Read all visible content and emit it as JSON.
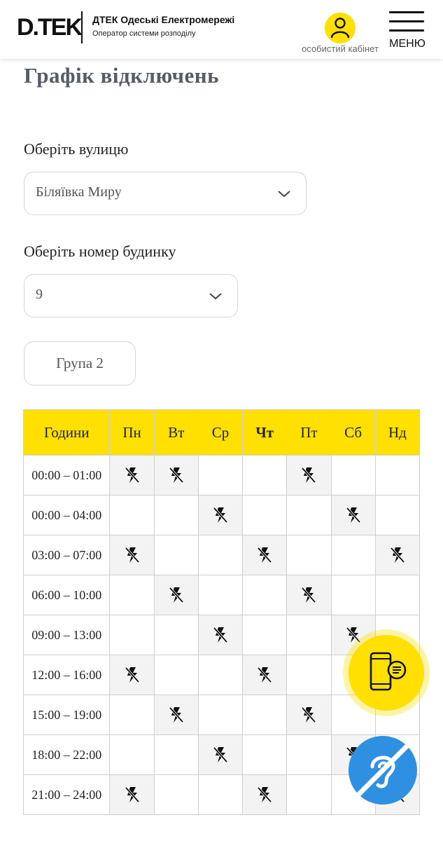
{
  "header": {
    "logo_text": "D.TEK",
    "company_name": "ДТЕК Одеські Електромережі",
    "company_subtitle": "Оператор системи розподілу",
    "cabinet_label": "особистий кабінет",
    "menu_label": "МЕНЮ"
  },
  "page": {
    "title": "Графік відключень"
  },
  "street": {
    "label": "Оберіть вулицю",
    "value": "Біляївка Миру"
  },
  "house": {
    "label": "Оберіть номер будинку",
    "value": "9"
  },
  "group": {
    "label": "Група 2"
  },
  "schedule": {
    "hours_header": "Години",
    "days": [
      "Пн",
      "Вт",
      "Ср",
      "Чт",
      "Пт",
      "Сб",
      "Нд"
    ],
    "today_index": 3,
    "rows": [
      {
        "time": "00:00 – 01:00",
        "outages": [
          true,
          true,
          false,
          false,
          true,
          false,
          false
        ]
      },
      {
        "time": "00:00 – 04:00",
        "outages": [
          false,
          false,
          true,
          false,
          false,
          true,
          false
        ]
      },
      {
        "time": "03:00 – 07:00",
        "outages": [
          true,
          false,
          false,
          true,
          false,
          false,
          true
        ]
      },
      {
        "time": "06:00 – 10:00",
        "outages": [
          false,
          true,
          false,
          false,
          true,
          false,
          false
        ]
      },
      {
        "time": "09:00 – 13:00",
        "outages": [
          false,
          false,
          true,
          false,
          false,
          true,
          false
        ]
      },
      {
        "time": "12:00 – 16:00",
        "outages": [
          true,
          false,
          false,
          true,
          false,
          false,
          true
        ]
      },
      {
        "time": "15:00 – 19:00",
        "outages": [
          false,
          true,
          false,
          false,
          true,
          false,
          false
        ]
      },
      {
        "time": "18:00 – 22:00",
        "outages": [
          false,
          false,
          true,
          false,
          false,
          true,
          false
        ]
      },
      {
        "time": "21:00 – 24:00",
        "outages": [
          true,
          false,
          false,
          true,
          false,
          false,
          true
        ]
      }
    ]
  },
  "icons": {
    "outage": "no-power-icon",
    "chat": "phone-chat-icon",
    "accessibility": "hearing-impaired-icon",
    "cabinet": "user-icon",
    "menu": "hamburger-icon"
  },
  "colors": {
    "accent": "#FFE000",
    "accessibility": "#2f8fe0",
    "outage_cell": "#f3f3f3"
  }
}
